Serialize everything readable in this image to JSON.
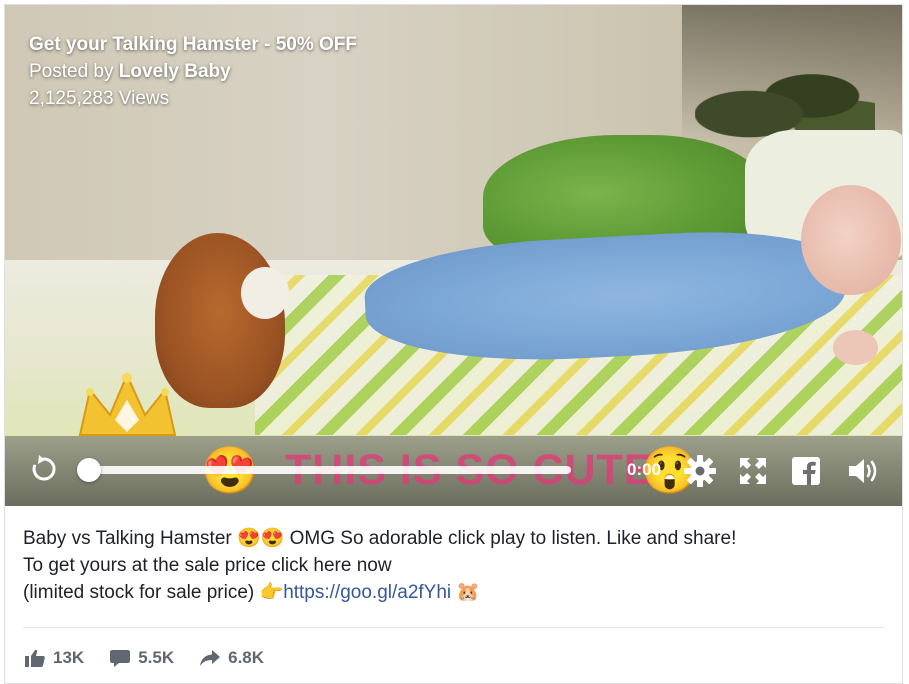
{
  "video": {
    "title": "Get your Talking Hamster - 50% OFF",
    "posted_by_prefix": "Posted by ",
    "posted_by_name": "Lovely Baby",
    "views": "2,125,283 Views",
    "overlay_caption": "THIS IS SO CUTE",
    "time": "0:00",
    "progress_fraction": 0.0
  },
  "post": {
    "line1_a": "Baby vs Talking Hamster ",
    "line1_emoji": "😍😍",
    "line1_b": " OMG So adorable click play to listen. Like and share!",
    "line2": "To get yours at the sale price click here now",
    "line3_a": "(limited stock for sale price) ",
    "line3_emoji": "👉",
    "link": "https://goo.gl/a2fYhi",
    "line3_end_emoji": "🐹"
  },
  "stats": {
    "likes": "13K",
    "comments": "5.5K",
    "shares": "6.8K"
  },
  "icons": [
    "replay-icon",
    "settings-gear-icon",
    "fullscreen-icon",
    "facebook-icon",
    "volume-icon",
    "like-icon",
    "comment-icon",
    "share-icon"
  ],
  "colors": {
    "link": "#365899",
    "text": "#1d2129",
    "stat": "#606770",
    "caption": "#e03a78"
  }
}
